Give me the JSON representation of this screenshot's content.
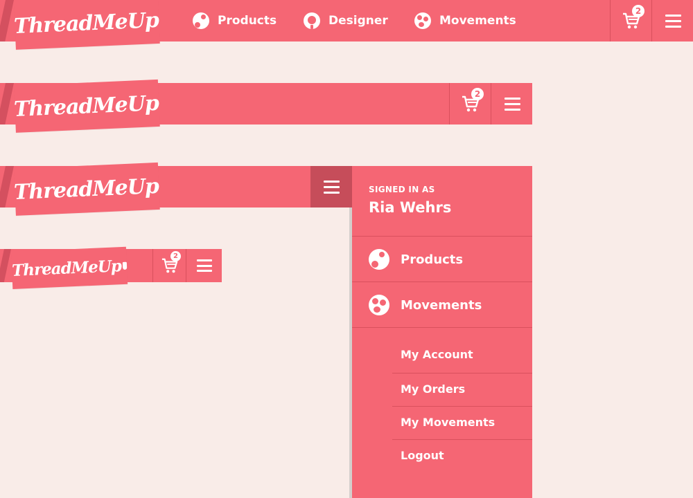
{
  "brand": {
    "logo_text": "ThreadMeUp"
  },
  "nav": {
    "items": [
      {
        "label": "Products",
        "icon": "products-icon"
      },
      {
        "label": "Designer",
        "icon": "designer-icon"
      },
      {
        "label": "Movements",
        "icon": "movements-icon"
      }
    ]
  },
  "cart": {
    "count": "2",
    "icon": "cart-icon"
  },
  "menu": {
    "icon": "hamburger-icon"
  },
  "drawer": {
    "signed_in_label": "SIGNED IN AS",
    "user_name": "Ria Wehrs",
    "main_items": [
      {
        "label": "Products",
        "icon": "products-icon"
      },
      {
        "label": "Movements",
        "icon": "movements-icon"
      }
    ],
    "sub_items": [
      {
        "label": "My Account"
      },
      {
        "label": "My Orders"
      },
      {
        "label": "My Movements"
      },
      {
        "label": "Logout"
      }
    ]
  },
  "colors": {
    "brand": "#f56674",
    "background": "#f9ece8",
    "divider": "#d9505d"
  }
}
